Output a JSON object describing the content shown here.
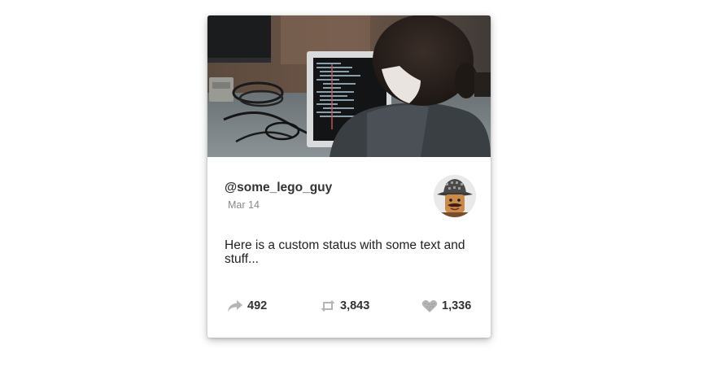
{
  "post": {
    "handle": "@some_lego_guy",
    "date": "Mar 14",
    "status_text": "Here is a custom status with some text and stuff...",
    "banner_image": "person-coding-on-laptop-photo",
    "avatar_image": "lego-minifigure-avatar"
  },
  "stats": {
    "shares": {
      "count": "492",
      "icon": "share-arrow-icon"
    },
    "retweets": {
      "count": "3,843",
      "icon": "retweet-icon"
    },
    "likes": {
      "count": "1,336",
      "icon": "heart-icon"
    }
  },
  "colors": {
    "text_primary": "#333333",
    "text_muted": "#8a8a8a",
    "icon_gray": "#b5b5b5"
  }
}
